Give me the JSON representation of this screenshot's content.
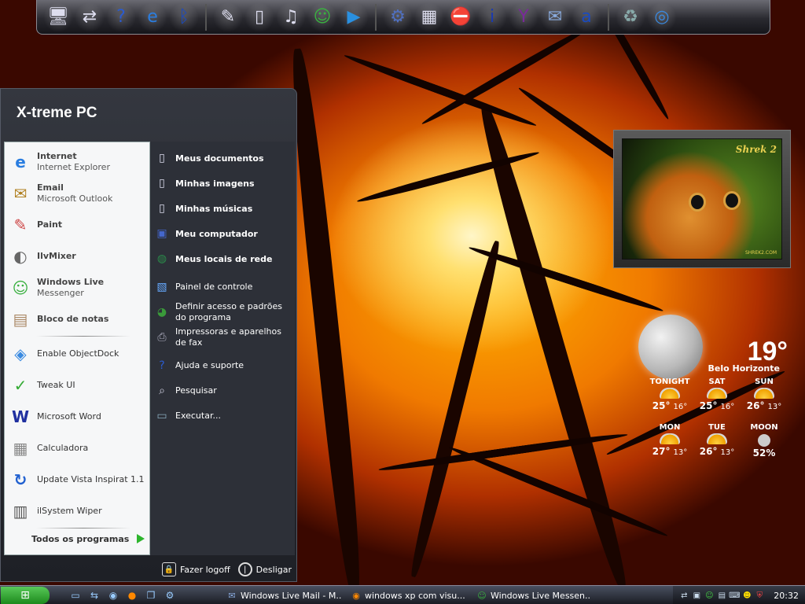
{
  "dock": {
    "icons": [
      "computer-icon",
      "network-icon",
      "help-icon",
      "internet-explorer-icon",
      "bluetooth-icon",
      "tools-icon",
      "documents-icon",
      "music-icon",
      "messenger-icon",
      "media-player-icon",
      "settings-gear-icon",
      "photo-gallery-icon",
      "security-icon",
      "info-icon",
      "yahoo-widgets-icon",
      "mail-icon",
      "amazon-icon",
      "recycle-bin-icon",
      "safari-icon"
    ]
  },
  "start_menu": {
    "title": "X-treme PC",
    "left_items": [
      {
        "name": "Internet",
        "sub": "Internet Explorer",
        "bold": true,
        "icon": "internet-explorer-icon"
      },
      {
        "name": "Email",
        "sub": "Microsoft Outlook",
        "bold": true,
        "icon": "outlook-icon"
      },
      {
        "name": "Paint",
        "sub": "",
        "bold": true,
        "icon": "paint-icon"
      },
      {
        "name": "IlvMixer",
        "sub": "",
        "bold": true,
        "icon": "mixer-icon"
      },
      {
        "name": "Windows Live",
        "sub": "Messenger",
        "bold": true,
        "icon": "messenger-icon"
      },
      {
        "name": "Bloco de notas",
        "sub": "",
        "bold": true,
        "icon": "notepad-icon"
      },
      {
        "name": "Enable ObjectDock",
        "sub": "",
        "bold": false,
        "icon": "objectdock-icon"
      },
      {
        "name": "Tweak UI",
        "sub": "",
        "bold": false,
        "icon": "tweak-ui-icon"
      },
      {
        "name": "Microsoft Word",
        "sub": "",
        "bold": false,
        "icon": "word-icon"
      },
      {
        "name": "Calculadora",
        "sub": "",
        "bold": false,
        "icon": "calculator-icon"
      },
      {
        "name": "Update Vista Inspirat 1.1",
        "sub": "",
        "bold": false,
        "icon": "update-icon"
      },
      {
        "name": "ilSystem Wiper",
        "sub": "",
        "bold": false,
        "icon": "trash-can-icon"
      }
    ],
    "all_programs": "Todos os programas",
    "right_items": [
      {
        "label": "Meus documentos",
        "bold": true,
        "icon": "my-documents-icon"
      },
      {
        "label": "Minhas imagens",
        "bold": true,
        "icon": "my-pictures-icon"
      },
      {
        "label": "Minhas músicas",
        "bold": true,
        "icon": "my-music-icon"
      },
      {
        "label": "Meu computador",
        "bold": true,
        "icon": "my-computer-icon"
      },
      {
        "label": "Meus locais de rede",
        "bold": true,
        "icon": "network-places-icon"
      },
      {
        "label": "Painel de controle",
        "bold": false,
        "icon": "control-panel-icon"
      },
      {
        "label": "Definir acesso e padrões do programa",
        "bold": false,
        "icon": "program-access-icon"
      },
      {
        "label": "Impressoras e aparelhos de fax",
        "bold": false,
        "icon": "printer-icon"
      },
      {
        "label": "Ajuda e suporte",
        "bold": false,
        "icon": "help-icon"
      },
      {
        "label": "Pesquisar",
        "bold": false,
        "icon": "search-icon"
      },
      {
        "label": "Executar...",
        "bold": false,
        "icon": "run-icon"
      }
    ],
    "logoff": "Fazer logoff",
    "shutdown": "Desligar"
  },
  "photo_widget": {
    "logo": "Shrek 2",
    "small_text": "SHREK2.COM"
  },
  "weather": {
    "temp": "19°",
    "city": "Belo Horizonte",
    "forecast": [
      {
        "label": "TONIGHT",
        "hi": "25°",
        "lo": "16°"
      },
      {
        "label": "SAT",
        "hi": "25°",
        "lo": "16°"
      },
      {
        "label": "SUN",
        "hi": "26°",
        "lo": "13°"
      },
      {
        "label": "MON",
        "hi": "27°",
        "lo": "13°"
      },
      {
        "label": "TUE",
        "hi": "26°",
        "lo": "13°"
      },
      {
        "label": "MOON",
        "hi": "52%",
        "lo": ""
      }
    ]
  },
  "taskbar": {
    "tasks": [
      {
        "label": "Windows Live Mail - M...",
        "icon": "mail-icon"
      },
      {
        "label": "windows xp com visu...",
        "icon": "firefox-icon"
      },
      {
        "label": "Windows Live Messen...",
        "icon": "messenger-icon"
      }
    ],
    "clock": "20:32"
  }
}
